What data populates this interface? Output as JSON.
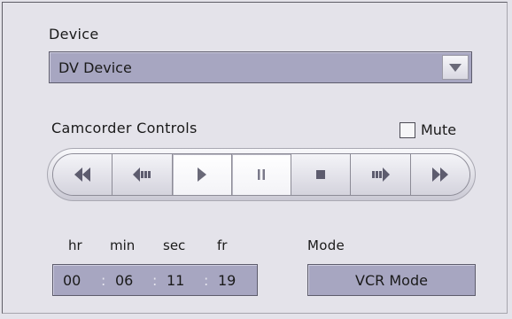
{
  "device": {
    "label": "Device",
    "selected": "DV Device"
  },
  "camcorder": {
    "label": "Camcorder Controls",
    "mute_label": "Mute",
    "mute_checked": false,
    "buttons": [
      {
        "name": "rewind",
        "icon": "rewind-icon"
      },
      {
        "name": "step-back",
        "icon": "step-back-icon"
      },
      {
        "name": "play",
        "icon": "play-icon"
      },
      {
        "name": "pause",
        "icon": "pause-icon"
      },
      {
        "name": "stop",
        "icon": "stop-icon"
      },
      {
        "name": "step-forward",
        "icon": "step-forward-icon"
      },
      {
        "name": "fast-forward",
        "icon": "fast-forward-icon"
      }
    ]
  },
  "timecode": {
    "labels": {
      "hr": "hr",
      "min": "min",
      "sec": "sec",
      "fr": "fr"
    },
    "hr": "00",
    "min": "06",
    "sec": "11",
    "fr": "19",
    "separator": ":"
  },
  "mode": {
    "label": "Mode",
    "value": "VCR Mode"
  }
}
